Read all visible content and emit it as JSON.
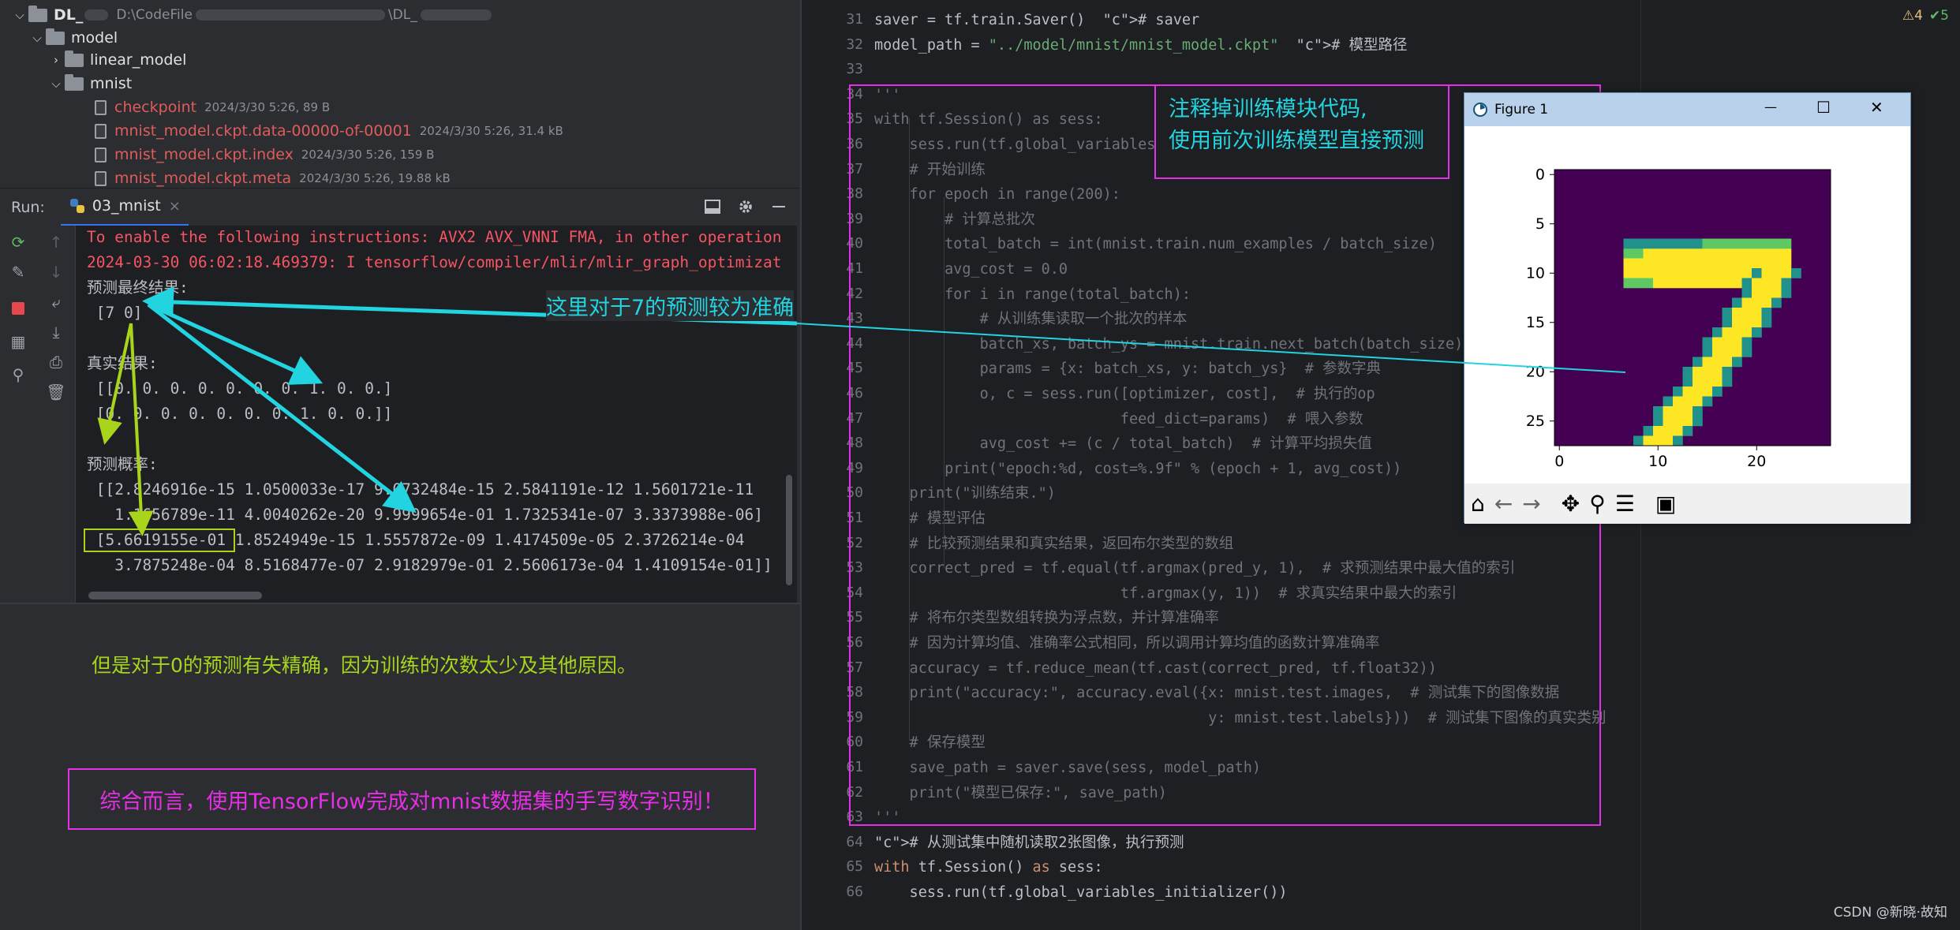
{
  "project": {
    "root_name": "DL_",
    "root_path": "D:\\CodeFile",
    "root_path_end": "\\DL_",
    "model_folder": "model",
    "linear_folder": "linear_model",
    "mnist_folder": "mnist",
    "files": [
      {
        "name": "checkpoint",
        "meta": "2024/3/30 5:26, 89 B"
      },
      {
        "name": "mnist_model.ckpt.data-00000-of-00001",
        "meta": "2024/3/30 5:26, 31.4 kB"
      },
      {
        "name": "mnist_model.ckpt.index",
        "meta": "2024/3/30 5:26, 159 B"
      },
      {
        "name": "mnist_model.ckpt.meta",
        "meta": "2024/3/30 5:26, 19.88 kB"
      }
    ]
  },
  "run": {
    "label": "Run:",
    "tab": "03_mnist",
    "close": "×"
  },
  "console": {
    "lines": [
      "To enable the following instructions: AVX2 AVX_VNNI FMA, in other operation",
      "2024-03-30 06:02:18.469379: I tensorflow/compiler/mlir/mlir_graph_optimizat",
      "预测最终结果:",
      " [7 0]",
      "",
      "真实结果:",
      " [[0. 0. 0. 0. 0. 0. 0. 1. 0. 0.]",
      " [0. 0. 0. 0. 0. 0. 0. 1. 0. 0.]]",
      "",
      "预测概率:",
      " [[2.8246916e-15 1.0500033e-17 9.0732484e-15 2.5841191e-12 1.5601721e-11",
      "   1.1656789e-11 4.0040262e-20 9.9999654e-01 1.7325341e-07 3.3373988e-06]",
      " [5.6619155e-01 1.8524949e-15 1.5557872e-09 1.4174509e-05 2.3726214e-04",
      "   3.7875248e-04 8.5168477e-07 2.9182979e-01 2.5606173e-04 1.4109154e-01]]"
    ]
  },
  "annotations": {
    "seven_correct": "这里对于7的预测较为准确",
    "zero_wrong": "但是对于0的预测有失精确，因为训练的次数太少及其他原因。",
    "summary": "综合而言，使用TensorFlow完成对mnist数据集的手写数字识别！",
    "comment_out_line1": "注释掉训练模块代码,",
    "comment_out_line2": "使用前次训练模型直接预测"
  },
  "editor": {
    "inspection_warn": "⚠4",
    "inspection_ok": "✔5",
    "line_numbers": [
      "31",
      "32",
      "33",
      "34",
      "35",
      "36",
      "37",
      "38",
      "39",
      "40",
      "41",
      "42",
      "43",
      "44",
      "45",
      "46",
      "47",
      "48",
      "49",
      "50",
      "51",
      "52",
      "53",
      "54",
      "55",
      "56",
      "57",
      "58",
      "59",
      "60",
      "61",
      "62",
      "63",
      "64",
      "65",
      "66"
    ],
    "lines": [
      "saver = tf.train.Saver()  # saver",
      "model_path = \"../model/mnist/mnist_model.ckpt\"  # 模型路径",
      "",
      "'''",
      "with tf.Session() as sess:",
      "    sess.run(tf.global_variables_initializer())  # 初始化",
      "    # 开始训练",
      "    for epoch in range(200):",
      "        # 计算总批次",
      "        total_batch = int(mnist.train.num_examples / batch_size)",
      "        avg_cost = 0.0",
      "        for i in range(total_batch):",
      "            # 从训练集读取一个批次的样本",
      "            batch_xs, batch_ys = mnist.train.next_batch(batch_size)",
      "            params = {x: batch_xs, y: batch_ys}  # 参数字典",
      "            o, c = sess.run([optimizer, cost],  # 执行的op",
      "                            feed_dict=params)  # 喂入参数",
      "            avg_cost += (c / total_batch)  # 计算平均损失值",
      "        print(\"epoch:%d, cost=%.9f\" % (epoch + 1, avg_cost))",
      "    print(\"训练结束.\")",
      "    # 模型评估",
      "    # 比较预测结果和真实结果，返回布尔类型的数组",
      "    correct_pred = tf.equal(tf.argmax(pred_y, 1),  # 求预测结果中最大值的索引",
      "                            tf.argmax(y, 1))  # 求真实结果中最大的索引",
      "    # 将布尔类型数组转换为浮点数，并计算准确率",
      "    # 因为计算均值、准确率公式相同，所以调用计算均值的函数计算准确率",
      "    accuracy = tf.reduce_mean(tf.cast(correct_pred, tf.float32))",
      "    print(\"accuracy:\", accuracy.eval({x: mnist.test.images,  # 测试集下的图像数据",
      "                                      y: mnist.test.labels}))  # 测试集下图像的真实类别",
      "    # 保存模型",
      "    save_path = saver.save(sess, model_path)",
      "    print(\"模型已保存:\", save_path)",
      "'''",
      "# 从测试集中随机读取2张图像，执行预测",
      "with tf.Session() as sess:",
      "    sess.run(tf.global_variables_initializer())"
    ]
  },
  "figure": {
    "title": "Figure 1",
    "minimize": "—",
    "maximize": "☐",
    "close": "✕",
    "y_ticks": [
      "0",
      "5",
      "10",
      "15",
      "20",
      "25"
    ],
    "x_ticks": [
      "0",
      "10",
      "20"
    ],
    "toolbar": [
      "home",
      "back",
      "forward",
      "pan",
      "zoom",
      "configure",
      "save"
    ]
  },
  "watermark": "CSDN @新晓·故知",
  "colors": {
    "magenta": "#e62ee6",
    "cyan": "#22d3e0",
    "yellow_green": "#a8d41c",
    "viridis_low": "#440154",
    "viridis_high": "#fde725"
  }
}
